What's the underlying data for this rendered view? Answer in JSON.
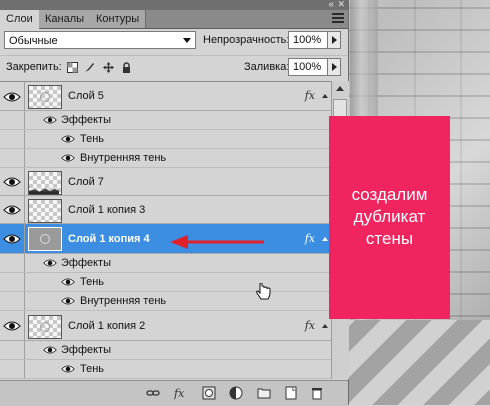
{
  "tabs": [
    {
      "label": "Слои",
      "active": true
    },
    {
      "label": "Каналы",
      "active": false
    },
    {
      "label": "Контуры",
      "active": false
    }
  ],
  "blend": {
    "mode": "Обычные",
    "opacity_label": "Непрозрачность:",
    "opacity_value": "100%"
  },
  "lock": {
    "label": "Закрепить:",
    "fill_label": "Заливка:",
    "fill_value": "100%"
  },
  "layers": {
    "l5": {
      "name": "Слой 5",
      "fx": "fx",
      "effects_label": "Эффекты",
      "effect1": "Тень",
      "effect2": "Внутренняя тень"
    },
    "l7": {
      "name": "Слой 7"
    },
    "l1c3": {
      "name": "Слой 1 копия 3"
    },
    "l1c4": {
      "name": "Слой 1 копия 4",
      "fx": "fx",
      "effects_label": "Эффекты",
      "effect1": "Тень",
      "effect2": "Внутренняя тень"
    },
    "l1c2": {
      "name": "Слой 1 копия 2",
      "fx": "fx",
      "effects_label": "Эффекты",
      "effect1": "Тень"
    }
  },
  "callout": {
    "text": "создалим дубликат стены"
  },
  "colors": {
    "callout": "#f0245f",
    "selection": "#3b8ee2",
    "arrow": "#e0202a"
  }
}
